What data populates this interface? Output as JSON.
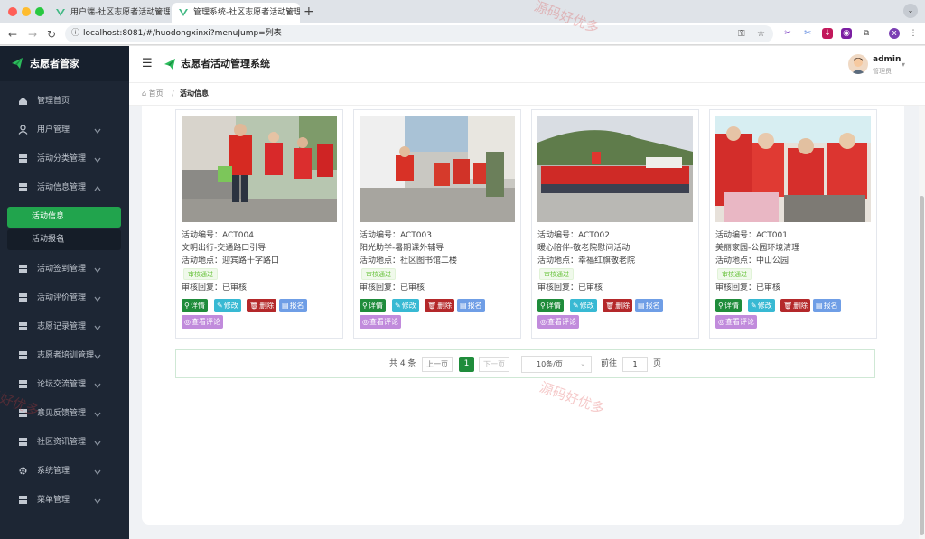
{
  "browser": {
    "tabs": [
      {
        "title": "用户端-社区志愿者活动管理系统"
      },
      {
        "title": "管理系统-社区志愿者活动管理系统"
      }
    ],
    "new_tab": "+",
    "url": "localhost:8081/#/huodongxinxi?menuJump=列表"
  },
  "sidebar": {
    "brand": "志愿者管家",
    "items": [
      {
        "label": "管理首页",
        "icon": "home-icon",
        "has_arrow": false
      },
      {
        "label": "用户管理",
        "icon": "user-icon",
        "has_arrow": true
      },
      {
        "label": "活动分类管理",
        "icon": "grid-icon",
        "has_arrow": true
      },
      {
        "label": "活动信息管理",
        "icon": "grid-icon",
        "has_arrow": true,
        "expanded": true
      },
      {
        "label": "活动签到管理",
        "icon": "grid-icon",
        "has_arrow": true
      },
      {
        "label": "活动评价管理",
        "icon": "grid-icon",
        "has_arrow": true
      },
      {
        "label": "志愿记录管理",
        "icon": "grid-icon",
        "has_arrow": true
      },
      {
        "label": "志愿者培训管理",
        "icon": "grid-icon",
        "has_arrow": true
      },
      {
        "label": "论坛交流管理",
        "icon": "grid-icon",
        "has_arrow": true
      },
      {
        "label": "意见反馈管理",
        "icon": "grid-icon",
        "has_arrow": true
      },
      {
        "label": "社区资讯管理",
        "icon": "grid-icon",
        "has_arrow": true
      },
      {
        "label": "系统管理",
        "icon": "gear-icon",
        "has_arrow": true
      },
      {
        "label": "菜单管理",
        "icon": "grid-icon",
        "has_arrow": true
      }
    ],
    "sub_items": [
      {
        "label": "活动信息",
        "active": true
      },
      {
        "label": "活动报名",
        "active": false
      }
    ]
  },
  "header": {
    "title": "志愿者活动管理系统",
    "username": "admin",
    "role": "管理员"
  },
  "breadcrumb": {
    "home": "首页",
    "separator": "/",
    "current": "活动信息"
  },
  "cards": [
    {
      "code_line": "活动编号：ACT004",
      "name": "文明出行-交通路口引导",
      "location_line": "活动地点：迎宾路十字路口",
      "status": "审核通过",
      "reply_line": "审核回复：已审核"
    },
    {
      "code_line": "活动编号：ACT003",
      "name": "阳光助学-暑期课外辅导",
      "location_line": "活动地点：社区图书馆二楼",
      "status": "审核通过",
      "reply_line": "审核回复：已审核"
    },
    {
      "code_line": "活动编号：ACT002",
      "name": "暖心陪伴-敬老院慰问活动",
      "location_line": "活动地点：幸福红旗敬老院",
      "status": "审核通过",
      "reply_line": "审核回复：已审核"
    },
    {
      "code_line": "活动编号：ACT001",
      "name": "美丽家园-公园环境清理",
      "location_line": "活动地点：中山公园",
      "status": "审核通过",
      "reply_line": "审核回复：已审核"
    }
  ],
  "card_buttons": {
    "detail": "详情",
    "edit": "修改",
    "delete": "删除",
    "signup": "报名",
    "comment": "查看评论"
  },
  "pagination": {
    "total": "共 4 条",
    "prev": "上一页",
    "current_page": "1",
    "next": "下一页",
    "page_size": "10条/页",
    "goto_label": "前往",
    "goto_value": "1",
    "page_suffix": "页"
  },
  "watermark": "源码好优多",
  "colors": {
    "sidebar_bg": "#1d2634",
    "accent_green": "#21a44d",
    "detail_btn": "#1f8c3b",
    "edit_btn": "#38b9d3",
    "delete_btn": "#b4282a",
    "signup_btn": "#6f9ee6",
    "comment_btn": "#c18bdc"
  }
}
